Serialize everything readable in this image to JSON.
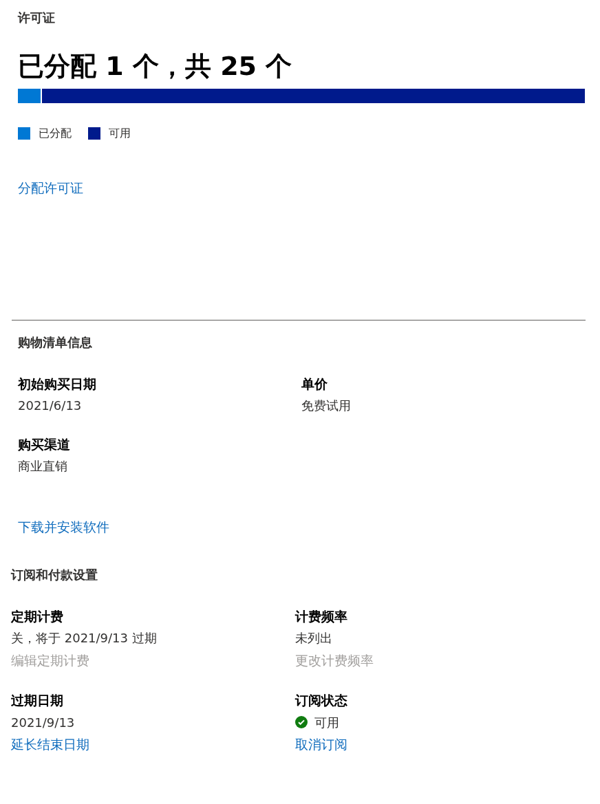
{
  "licenses": {
    "title": "许可证",
    "summary": "已分配 1 个，共 25 个",
    "bar": {
      "level": 0.04
    },
    "legend": [
      {
        "label": "已分配",
        "color": "#0078d4"
      },
      {
        "label": "可用",
        "color": "#001a8c"
      }
    ],
    "link": "分配许可证"
  },
  "order_info": {
    "title": "购物清单信息",
    "fields": [
      {
        "label": "初始购买日期",
        "value": "2021/6/13"
      },
      {
        "label": "单价",
        "value": "免费试用"
      },
      {
        "label": "购买渠道",
        "value": "商业直销"
      }
    ],
    "link": "下载并安装软件"
  },
  "subscription": {
    "title": "订阅和付款设置",
    "fields": [
      {
        "label": "定期计费",
        "value": "关，将于 2021/9/13 过期",
        "link": {
          "text": "编辑定期计费",
          "disabled": true
        }
      },
      {
        "label": "计费频率",
        "value": "未列出",
        "link": {
          "text": "更改计费频率",
          "disabled": true
        }
      },
      {
        "label": "过期日期",
        "value": "2021/9/13",
        "link": {
          "text": "延长结束日期",
          "disabled": false
        }
      },
      {
        "label": "订阅状态",
        "value": "可用",
        "ok": true,
        "link": {
          "text": "取消订阅",
          "disabled": false
        }
      }
    ]
  }
}
